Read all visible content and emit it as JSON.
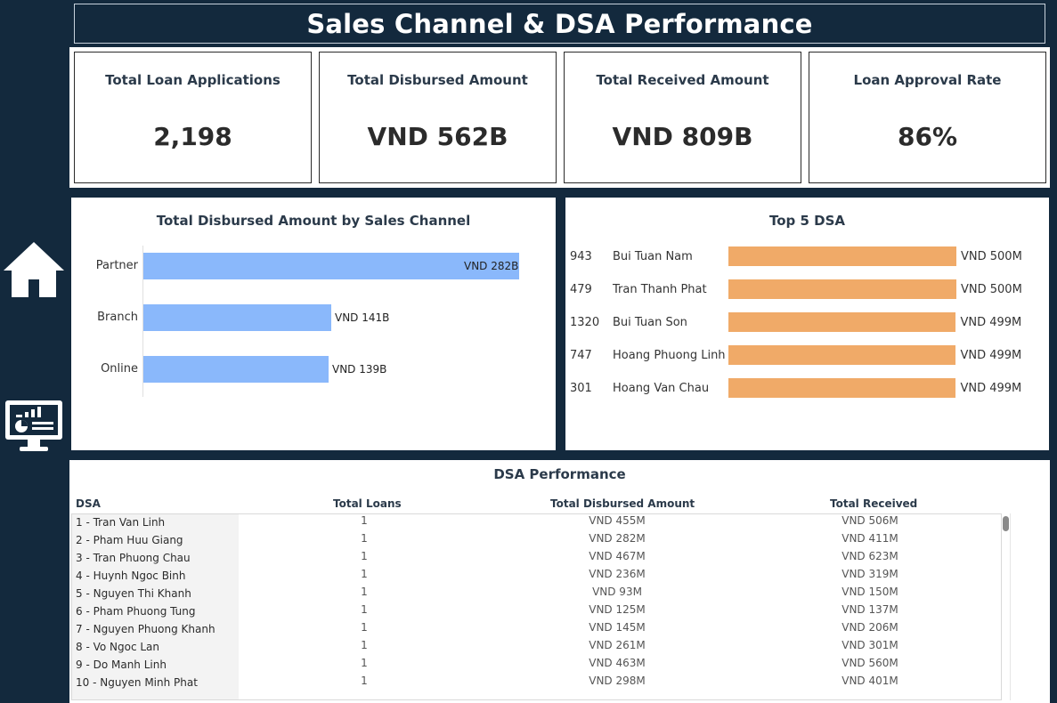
{
  "title": "Sales Channel & DSA Performance",
  "colors": {
    "background": "#13293d",
    "channel_bar": "#8ab8fb",
    "dsa_bar": "#f0aa68"
  },
  "nav": {
    "home_icon": "home-icon",
    "dashboard_icon": "dashboard-monitor-icon"
  },
  "kpis": [
    {
      "label": "Total Loan Applications",
      "value": "2,198"
    },
    {
      "label": "Total Disbursed Amount",
      "value": "VND 562B"
    },
    {
      "label": "Total Received Amount",
      "value": "VND 809B"
    },
    {
      "label": "Loan Approval Rate",
      "value": "86%"
    }
  ],
  "channel_chart": {
    "title": "Total Disbursed Amount by Sales Channel",
    "chart_data": {
      "type": "bar",
      "orientation": "horizontal",
      "categories": [
        "Partner",
        "Branch",
        "Online"
      ],
      "values": [
        282,
        141,
        139
      ],
      "value_labels": [
        "VND 282B",
        "VND 141B",
        "VND 139B"
      ],
      "unit": "VND B"
    }
  },
  "top_dsa_chart": {
    "title": "Top 5 DSA",
    "chart_data": {
      "type": "bar",
      "orientation": "horizontal",
      "ids": [
        "943",
        "479",
        "1320",
        "747",
        "301"
      ],
      "categories": [
        "Bui Tuan Nam",
        "Tran Thanh Phat",
        "Bui Tuan Son",
        "Hoang Phuong Linh",
        "Hoang Van Chau"
      ],
      "values": [
        500,
        500,
        499,
        499,
        499
      ],
      "value_labels": [
        "VND 500M",
        "VND 500M",
        "VND 499M",
        "VND 499M",
        "VND 499M"
      ],
      "unit": "VND M"
    }
  },
  "table": {
    "title": "DSA Performance",
    "headers": {
      "dsa": "DSA",
      "loans": "Total Loans",
      "disbursed": "Total Disbursed  Amount",
      "received": "Total Received"
    },
    "rows": [
      {
        "dsa": "1 - Tran Van Linh",
        "loans": "1",
        "disbursed": "VND 455M",
        "received": "VND 506M"
      },
      {
        "dsa": "2 - Pham Huu Giang",
        "loans": "1",
        "disbursed": "VND 282M",
        "received": "VND 411M"
      },
      {
        "dsa": "3 - Tran Phuong Chau",
        "loans": "1",
        "disbursed": "VND 467M",
        "received": "VND 623M"
      },
      {
        "dsa": "4 - Huynh Ngoc Binh",
        "loans": "1",
        "disbursed": "VND 236M",
        "received": "VND 319M"
      },
      {
        "dsa": "5 - Nguyen Thi Khanh",
        "loans": "1",
        "disbursed": "VND 93M",
        "received": "VND 150M"
      },
      {
        "dsa": "6 - Pham Phuong Tung",
        "loans": "1",
        "disbursed": "VND 125M",
        "received": "VND 137M"
      },
      {
        "dsa": "7 - Nguyen Phuong Khanh",
        "loans": "1",
        "disbursed": "VND 145M",
        "received": "VND 206M"
      },
      {
        "dsa": "8 - Vo Ngoc Lan",
        "loans": "1",
        "disbursed": "VND 261M",
        "received": "VND 301M"
      },
      {
        "dsa": "9 - Do Manh Linh",
        "loans": "1",
        "disbursed": "VND 463M",
        "received": "VND 560M"
      },
      {
        "dsa": "10 - Nguyen Minh Phat",
        "loans": "1",
        "disbursed": "VND 298M",
        "received": "VND 401M"
      }
    ]
  }
}
